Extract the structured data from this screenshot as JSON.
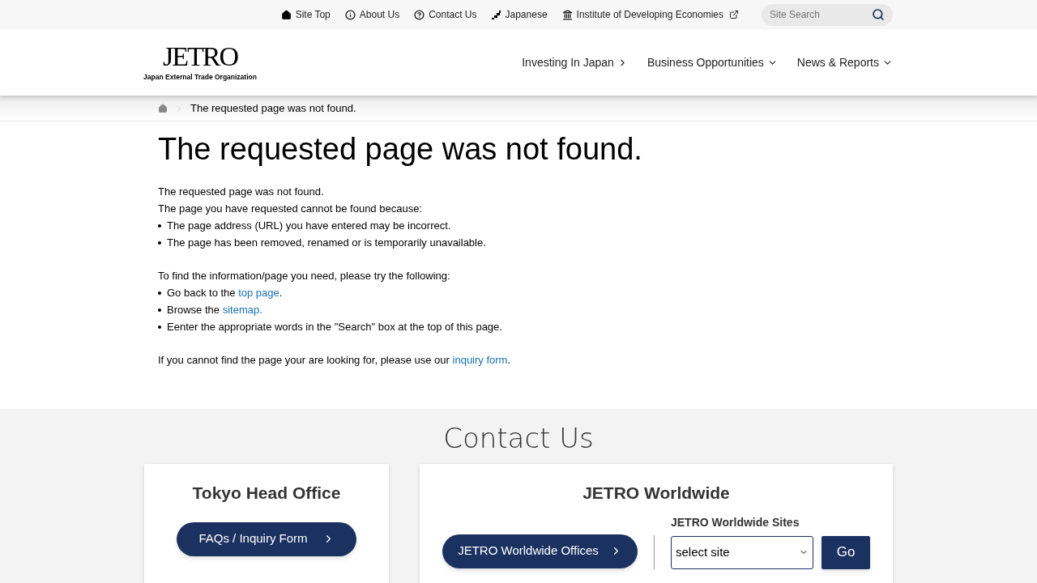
{
  "top_links": [
    {
      "kind": "home",
      "label": "Site Top"
    },
    {
      "kind": "info",
      "label": "About Us"
    },
    {
      "kind": "help",
      "label": "Contact Us"
    },
    {
      "kind": "japan",
      "label": "Japanese"
    },
    {
      "kind": "institute",
      "label": "Institute of Developing Economies"
    }
  ],
  "search": {
    "placeholder": "Site Search"
  },
  "logo": {
    "mark": "JETRO",
    "subtitle": "Japan External Trade Organization"
  },
  "nav": [
    {
      "label": "Investing In Japan",
      "kind": "link"
    },
    {
      "label": "Business Opportunities",
      "kind": "menu"
    },
    {
      "label": "News & Reports",
      "kind": "menu"
    }
  ],
  "breadcrumb": "The requested page was not found.",
  "heading": "The requested page was not found.",
  "intro": [
    "The requested page was not found.",
    "The page you have requested cannot be found because:"
  ],
  "reasons": [
    "The page address (URL) you have entered may be incorrect.",
    "The page has been removed, renamed or is temporarily unavailable."
  ],
  "try_text": "To find the information/page you need, please try the following:",
  "suggestions": [
    {
      "before": "Go back to the ",
      "link": "top page",
      "after": "."
    },
    {
      "before": "Browse the ",
      "link": "sitemap."
    },
    {
      "before": "Eenter the appropriate words in the \"Search\" box at the top of this page."
    }
  ],
  "closing": {
    "before": "If you cannot find the page your are looking for, please use our ",
    "link": "inquiry form",
    "after": "."
  },
  "contact": {
    "title": "Contact Us",
    "tokyo": {
      "title": "Tokyo Head Office",
      "button": "FAQs / Inquiry Form"
    },
    "worldwide": {
      "title": "JETRO Worldwide",
      "button": "JETRO Worldwide Offices",
      "sites_label": "JETRO Worldwide Sites",
      "select": "select site",
      "go": "Go"
    }
  }
}
